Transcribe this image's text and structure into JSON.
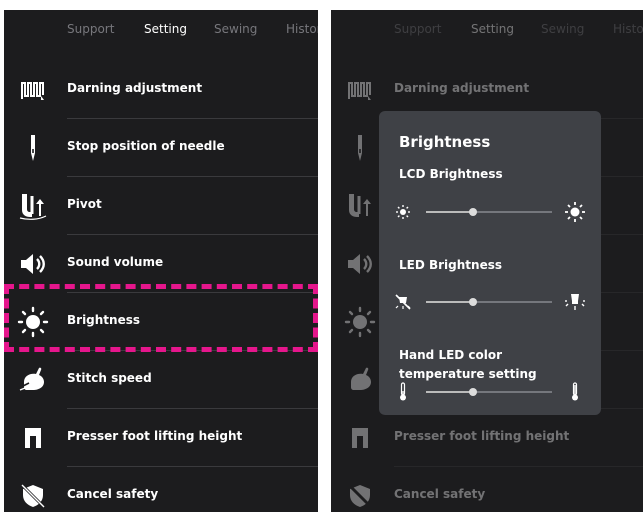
{
  "tabs": [
    "Support",
    "Setting",
    "Sewing",
    "History"
  ],
  "active_tab": 1,
  "menu": [
    {
      "icon": "darning-icon",
      "label": "Darning adjustment"
    },
    {
      "icon": "needle-icon",
      "label": "Stop position of needle"
    },
    {
      "icon": "pivot-icon",
      "label": "Pivot"
    },
    {
      "icon": "speaker-icon",
      "label": "Sound volume"
    },
    {
      "icon": "sun-icon",
      "label": "Brightness"
    },
    {
      "icon": "rabbit-icon",
      "label": "Stitch speed"
    },
    {
      "icon": "presser-foot-icon",
      "label": "Presser foot lifting height"
    },
    {
      "icon": "cancel-safety-icon",
      "label": "Cancel safety"
    }
  ],
  "highlighted_item": "Brightness",
  "highlight_color": "#e5168c",
  "brightness_popup": {
    "title": "Brightness",
    "lcd": {
      "label": "LCD Brightness",
      "level": 0.37,
      "icon_low": "sun-small-icon",
      "icon_high": "sun-large-icon"
    },
    "led": {
      "label": "LED Brightness",
      "level": 0.37,
      "icon_low": "lamp-off-icon",
      "icon_high": "lamp-on-icon"
    },
    "hand_led": {
      "label": "Hand LED color temperature setting",
      "level": 0.37,
      "icon_low": "thermometer-low-icon",
      "icon_high": "thermometer-high-icon"
    }
  }
}
